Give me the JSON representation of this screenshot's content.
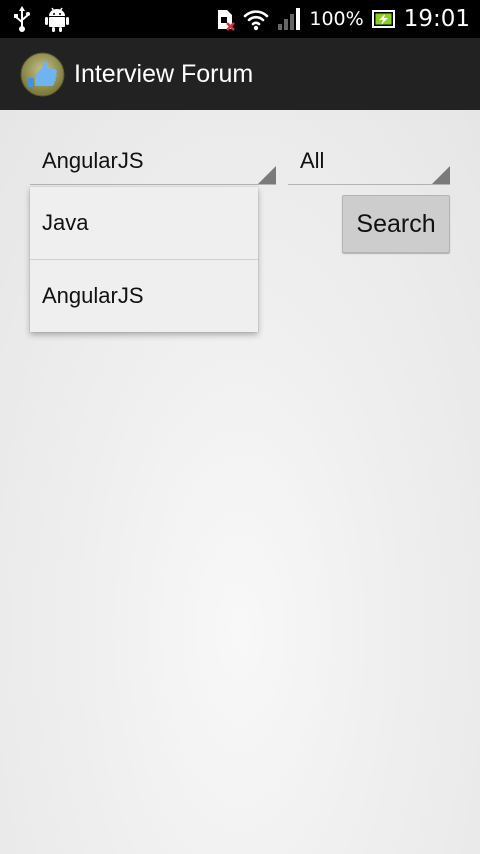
{
  "status_bar": {
    "battery": "100%",
    "time": "19:01",
    "icons": [
      "usb-icon",
      "android-debug-icon",
      "sim-error-icon",
      "wifi-icon",
      "signal-icon",
      "battery-charging-icon"
    ]
  },
  "action_bar": {
    "title": "Interview Forum",
    "icon": "thumbs-up-icon"
  },
  "form": {
    "category_spinner": {
      "selected": "AngularJS"
    },
    "level_spinner": {
      "selected": "All"
    },
    "search_label": "Search"
  },
  "dropdown": {
    "options": [
      "Java",
      "AngularJS"
    ]
  },
  "colors": {
    "status_bar": "#000000",
    "action_bar": "#222222",
    "background": "#e9e9e9",
    "button": "#cdcdcd"
  }
}
